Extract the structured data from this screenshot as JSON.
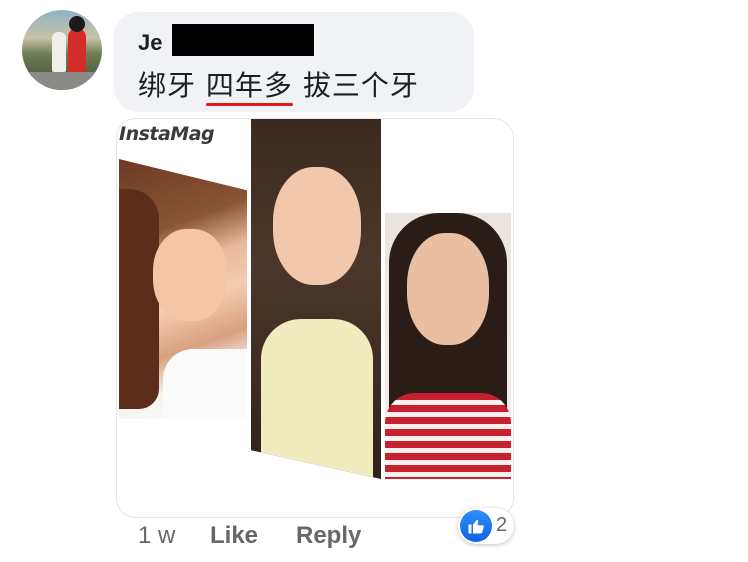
{
  "comment": {
    "author": "Je",
    "message_parts": [
      "绑牙 ",
      "四年多",
      " 拔三个牙"
    ],
    "photo_brand": "InstaMag",
    "timestamp": "1 w",
    "actions": {
      "like": "Like",
      "reply": "Reply"
    },
    "reaction_icon": "thumbs-up-icon",
    "reaction_count": "2"
  },
  "colors": {
    "bubble": "#f0f2f5",
    "accent": "#1877f2",
    "highlight_underline": "#e0191f",
    "meta_text": "#65676b"
  }
}
